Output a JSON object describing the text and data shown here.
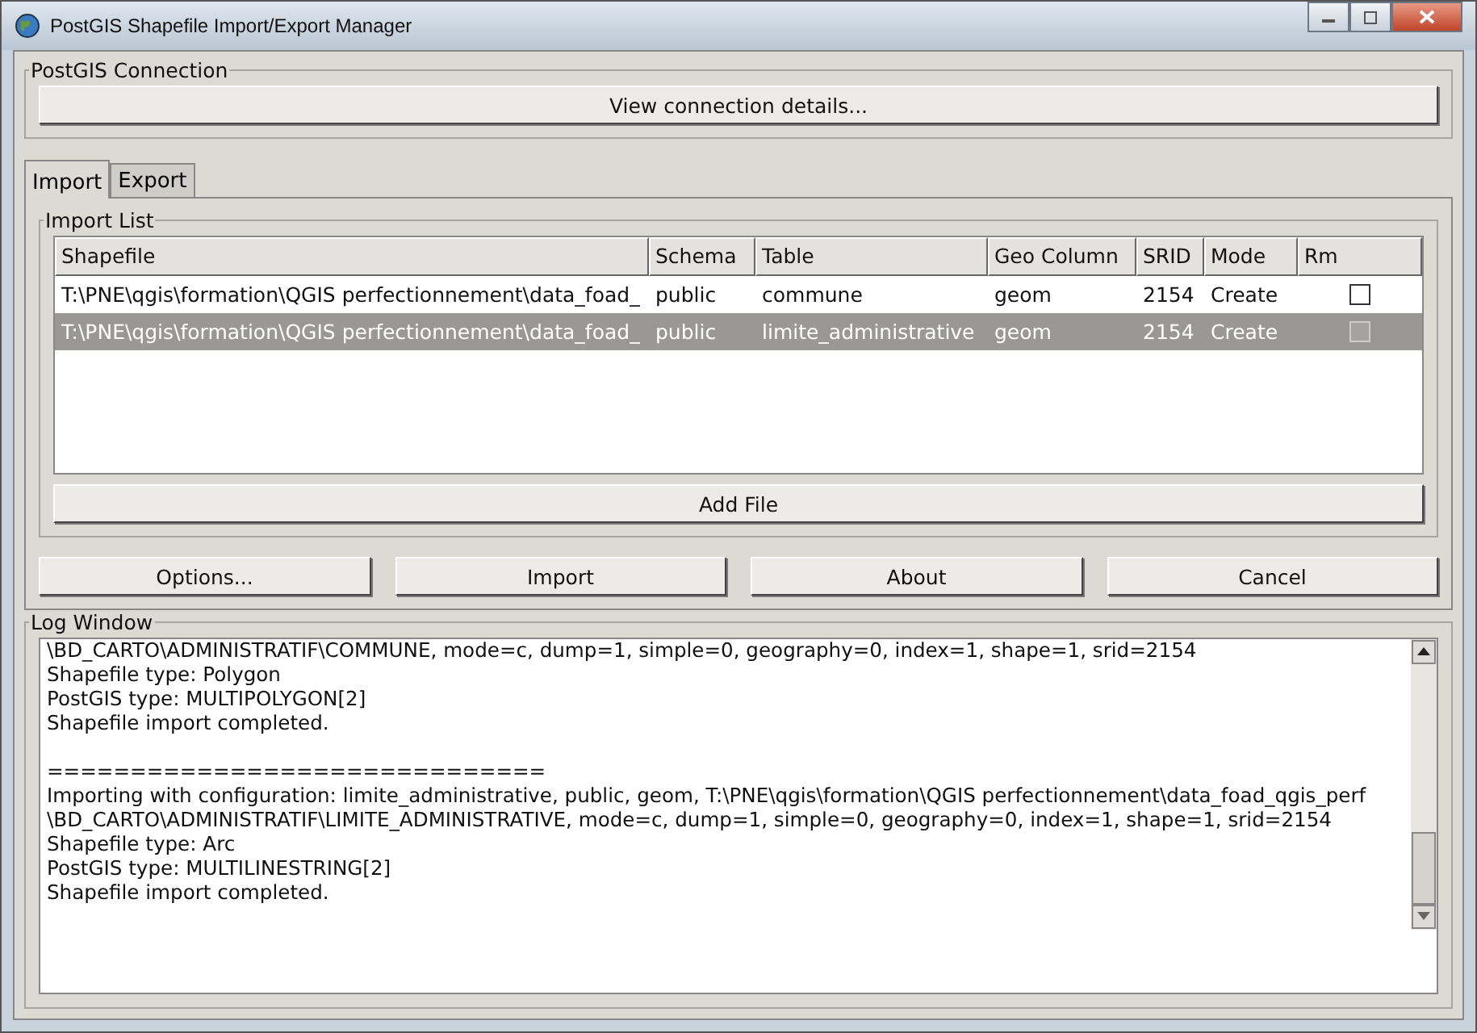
{
  "window": {
    "title": "PostGIS Shapefile Import/Export Manager"
  },
  "connection": {
    "title": "PostGIS Connection",
    "button": "View connection details..."
  },
  "tabs": [
    {
      "label": "Import",
      "selected": true
    },
    {
      "label": "Export",
      "selected": false
    }
  ],
  "import_list": {
    "title": "Import List",
    "columns": [
      "Shapefile",
      "Schema",
      "Table",
      "Geo Column",
      "SRID",
      "Mode",
      "Rm"
    ],
    "rows": [
      {
        "shapefile": "T:\\PNE\\qgis\\formation\\QGIS perfectionnement\\data_foad_",
        "schema": "public",
        "table": "commune",
        "geo_column": "geom",
        "srid": "2154",
        "mode": "Create",
        "rm": false,
        "selected": false
      },
      {
        "shapefile": "T:\\PNE\\qgis\\formation\\QGIS perfectionnement\\data_foad_",
        "schema": "public",
        "table": "limite_administrative",
        "geo_column": "geom",
        "srid": "2154",
        "mode": "Create",
        "rm": false,
        "selected": true
      }
    ],
    "add_button": "Add File"
  },
  "buttons": [
    "Options...",
    "Import",
    "About",
    "Cancel"
  ],
  "log": {
    "title": "Log Window",
    "blocks": [
      [
        "\\BD_CARTO\\ADMINISTRATIF\\COMMUNE, mode=c, dump=1, simple=0, geography=0, index=1, shape=1, srid=2154",
        "Shapefile type: Polygon",
        "PostGIS type: MULTIPOLYGON[2]",
        "Shapefile import completed."
      ],
      [
        "==============================",
        "Importing with configuration: limite_administrative, public, geom, T:\\PNE\\qgis\\formation\\QGIS perfectionnement\\data_foad_qgis_perf",
        "\\BD_CARTO\\ADMINISTRATIF\\LIMITE_ADMINISTRATIVE, mode=c, dump=1, simple=0, geography=0, index=1, shape=1, srid=2154",
        "Shapefile type: Arc",
        "PostGIS type: MULTILINESTRING[2]",
        "Shapefile import completed."
      ]
    ]
  }
}
